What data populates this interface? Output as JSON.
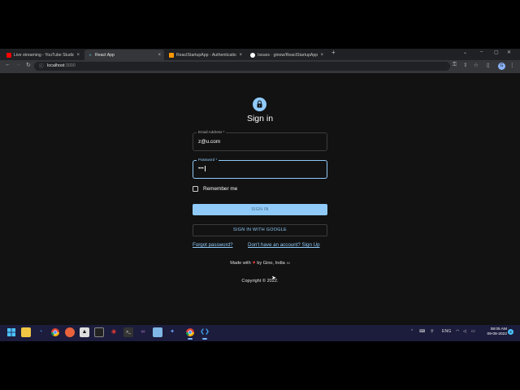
{
  "browser": {
    "tabs": [
      {
        "label": "Live streaming - YouTube Studio",
        "fav_color": "#ff0000",
        "active": false
      },
      {
        "label": "React App",
        "fav_color": "#61dafb",
        "active": true
      },
      {
        "label": "ReactStartupApp - Authenticatio",
        "fav_color": "#ff9800",
        "active": false
      },
      {
        "label": "Issues · ginow/ReactStartupApp",
        "fav_color": "#ffffff",
        "active": false
      }
    ],
    "new_tab_glyph": "+",
    "close_glyph": "×",
    "url_host": "localhost",
    "url_port": ":3000",
    "profile_initial": "G"
  },
  "signin_form": {
    "title": "Sign in",
    "email": {
      "label": "Email Address *",
      "value": "z@u.com"
    },
    "password": {
      "label": "Password *",
      "value": "•••"
    },
    "remember_label": "Remember me",
    "signin_button": "SIGN IN",
    "google_button": "SIGN IN WITH GOOGLE",
    "forgot_link": "Forgot password?",
    "signup_link": "Don't have an account? Sign Up",
    "made_with_prefix": "Made with",
    "made_with_suffix": "by Gino, India",
    "flag_text": "IN",
    "copyright": "Copyright © 2022."
  },
  "accent_colors": {
    "primary": "#90caf9",
    "heart": "#e53935",
    "page_bg": "#121212"
  },
  "taskbar": {
    "tray_lang": "ENG",
    "clock_time": "08:05 AM",
    "clock_date": "09-09-2022",
    "notif_count": "2"
  }
}
